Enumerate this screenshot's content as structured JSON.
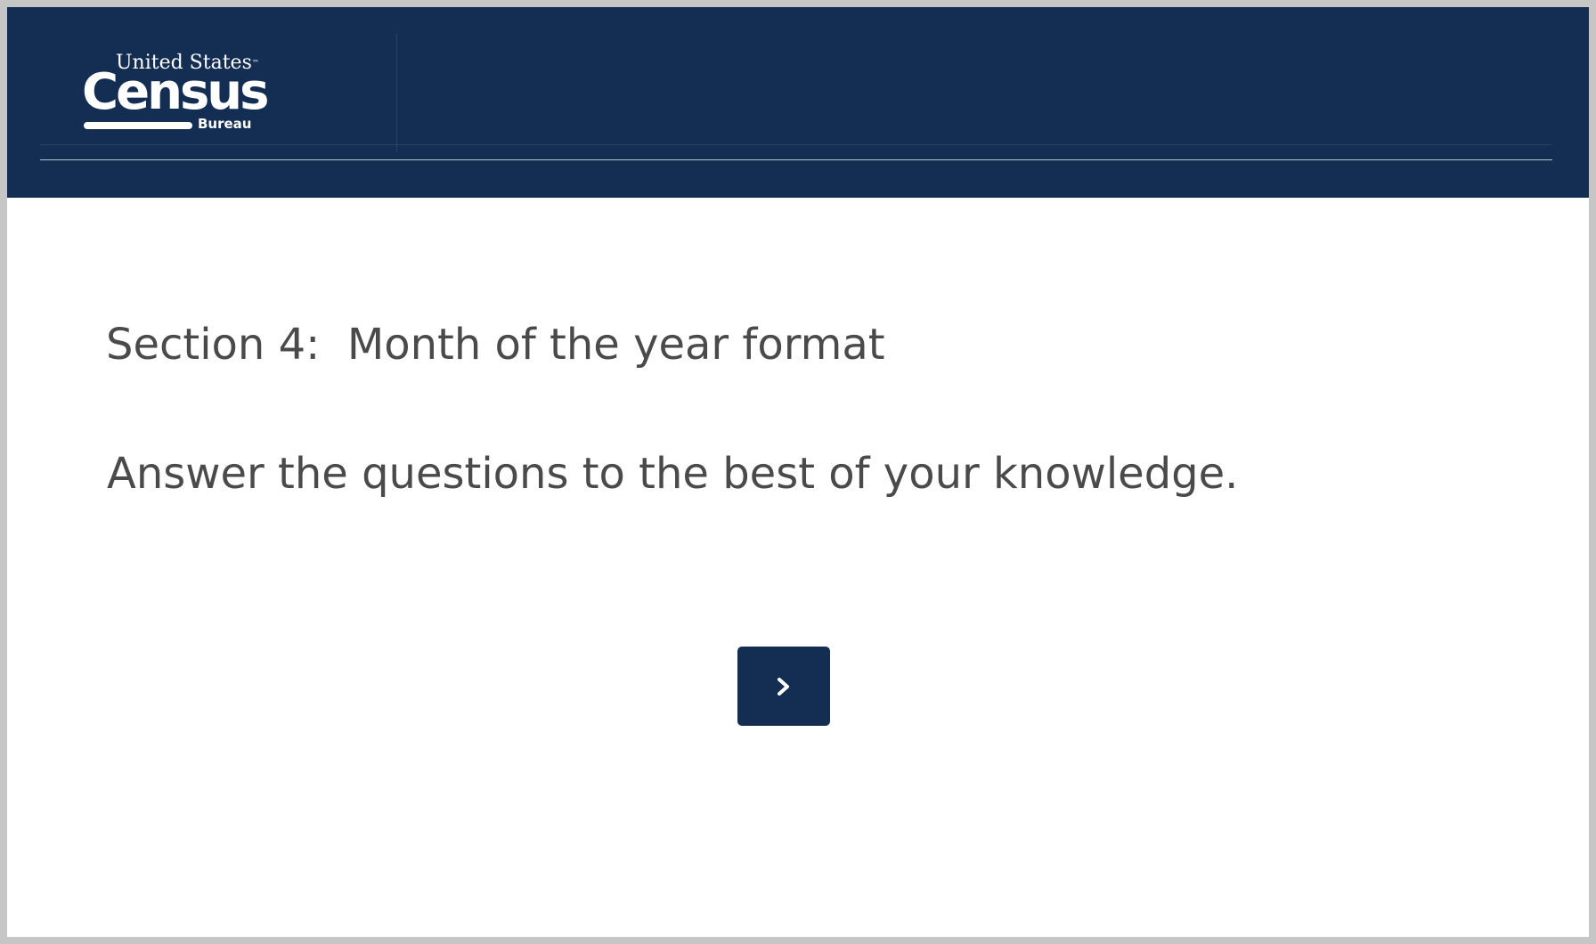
{
  "header": {
    "logo": {
      "top_text": "United States",
      "trademark": "™",
      "main_text": "Census",
      "sub_text": "Bureau"
    }
  },
  "main": {
    "section_title": "Section 4:  Month of the year format",
    "instructions": "Answer the questions to the best of your knowledge."
  },
  "navigation": {
    "next_button_icon": "chevron-right-icon"
  },
  "colors": {
    "header_background": "#132e52",
    "button_background": "#132e52",
    "text": "#4a4a4a",
    "page_background": "#ffffff"
  }
}
